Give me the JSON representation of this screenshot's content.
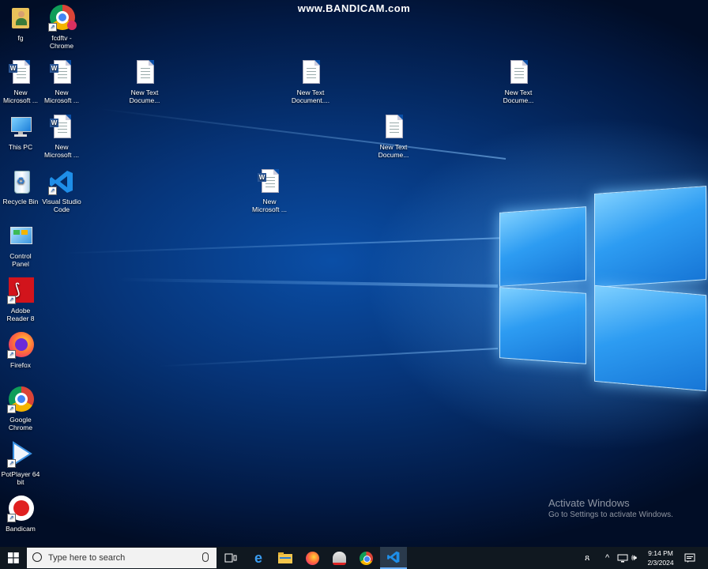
{
  "watermark": "www.BANDICAM.com",
  "desktop_icons": [
    {
      "name": "fg",
      "label": "fg",
      "kind": "user-folder-icon"
    },
    {
      "name": "fcdftv-chrome",
      "label": "fcdftv -\nChrome",
      "kind": "chrome-profile-icon"
    },
    {
      "name": "new-microsoft-1",
      "label": "New\nMicrosoft ...",
      "kind": "word-doc-icon"
    },
    {
      "name": "new-microsoft-2",
      "label": "New\nMicrosoft ...",
      "kind": "word-doc-icon"
    },
    {
      "name": "new-text-doc-1",
      "label": "New Text\nDocume...",
      "kind": "text-doc-icon"
    },
    {
      "name": "new-text-doc-2",
      "label": "New Text\nDocument....",
      "kind": "text-doc-icon"
    },
    {
      "name": "new-text-doc-3",
      "label": "New Text\nDocume...",
      "kind": "text-doc-icon"
    },
    {
      "name": "this-pc",
      "label": "This PC",
      "kind": "computer-icon"
    },
    {
      "name": "new-microsoft-3",
      "label": "New\nMicrosoft ...",
      "kind": "word-doc-icon"
    },
    {
      "name": "new-text-doc-4",
      "label": "New Text\nDocume...",
      "kind": "text-doc-icon"
    },
    {
      "name": "recycle-bin",
      "label": "Recycle Bin",
      "kind": "recycle-bin-icon"
    },
    {
      "name": "visual-studio-code",
      "label": "Visual Studio\nCode",
      "kind": "vscode-icon"
    },
    {
      "name": "new-microsoft-4",
      "label": "New\nMicrosoft ...",
      "kind": "word-doc-icon"
    },
    {
      "name": "control-panel",
      "label": "Control\nPanel",
      "kind": "control-panel-icon"
    },
    {
      "name": "adobe-reader",
      "label": "Adobe\nReader 8",
      "kind": "pdf-icon"
    },
    {
      "name": "firefox",
      "label": "Firefox",
      "kind": "firefox-icon"
    },
    {
      "name": "google-chrome",
      "label": "Google\nChrome",
      "kind": "chrome-icon"
    },
    {
      "name": "potplayer",
      "label": "PotPlayer 64\nbit",
      "kind": "potplayer-icon"
    },
    {
      "name": "bandicam",
      "label": "Bandicam",
      "kind": "bandicam-icon"
    }
  ],
  "activation": {
    "title": "Activate Windows",
    "subtitle": "Go to Settings to activate Windows."
  },
  "taskbar": {
    "search_placeholder": "Type here to search",
    "pinned": [
      "task-view-icon",
      "edge-icon",
      "file-explorer-icon",
      "firefox-icon",
      "network-app-icon",
      "chrome-icon",
      "vscode-icon"
    ],
    "active_app": "vscode-icon"
  },
  "tray": {
    "time": "9:14 PM",
    "date": "2/3/2024"
  },
  "colors": {
    "accent": "#0078d7",
    "taskbar": "#101820"
  }
}
